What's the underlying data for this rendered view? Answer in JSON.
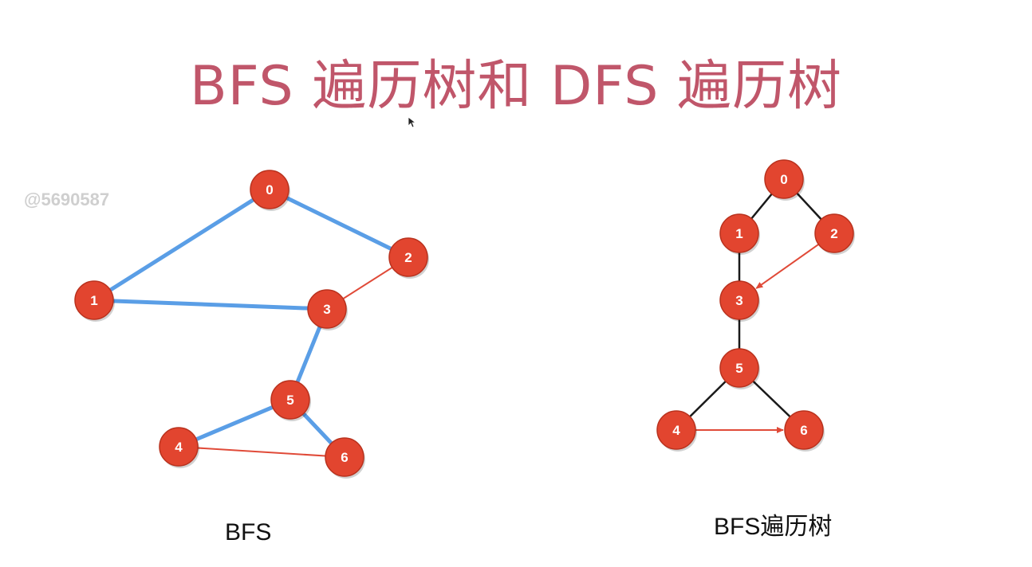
{
  "title": "BFS 遍历树和 DFS 遍历树",
  "watermark": "@5690587",
  "colors": {
    "title": "#c0566a",
    "node_fill": "#e2452f",
    "node_stroke": "#b9321e",
    "tree_edge_graph": "#5a9ee6",
    "non_tree_edge": "#e04a38",
    "tree_edge_tree": "#1a1a1a"
  },
  "left_graph": {
    "caption": "BFS",
    "nodes": [
      "0",
      "1",
      "2",
      "3",
      "4",
      "5",
      "6"
    ],
    "tree_edges": [
      [
        "0",
        "1"
      ],
      [
        "0",
        "2"
      ],
      [
        "1",
        "3"
      ],
      [
        "3",
        "5"
      ],
      [
        "5",
        "4"
      ],
      [
        "5",
        "6"
      ]
    ],
    "non_tree_edges": [
      [
        "2",
        "3"
      ],
      [
        "4",
        "6"
      ]
    ]
  },
  "right_graph": {
    "caption": "BFS遍历树",
    "nodes": [
      "0",
      "1",
      "2",
      "3",
      "4",
      "5",
      "6"
    ],
    "tree_edges": [
      [
        "0",
        "1"
      ],
      [
        "0",
        "2"
      ],
      [
        "1",
        "3"
      ],
      [
        "3",
        "5"
      ],
      [
        "5",
        "4"
      ],
      [
        "5",
        "6"
      ]
    ],
    "non_tree_edges_directed": [
      [
        "2",
        "3"
      ],
      [
        "4",
        "6"
      ]
    ]
  }
}
